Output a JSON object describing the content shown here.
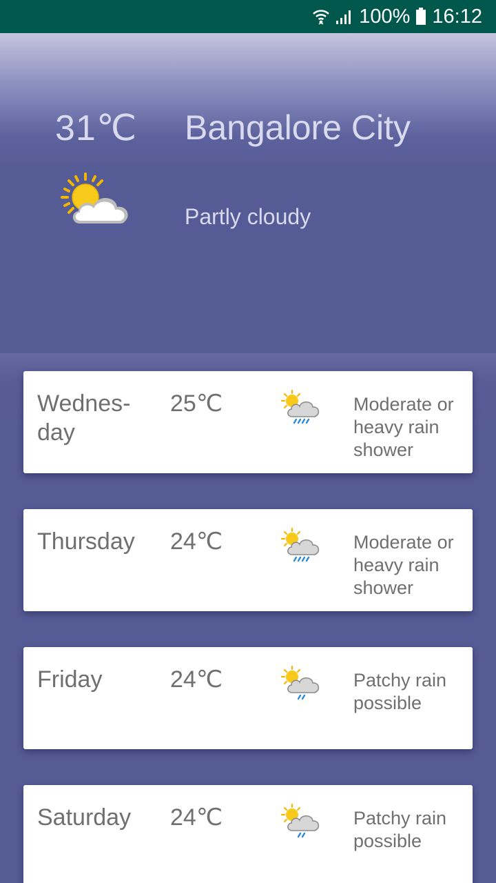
{
  "status_bar": {
    "battery": "100%",
    "time": "16:12"
  },
  "current": {
    "temperature": "31℃",
    "city": "Bangalore City",
    "condition": "Partly cloudy",
    "icon": "partly-cloudy-icon"
  },
  "forecast": [
    {
      "day": "Wednes-\nday",
      "temp": "25℃",
      "condition": "Moderate or heavy rain shower",
      "icon": "sun-cloud-rain-icon"
    },
    {
      "day": "Thursday",
      "temp": "24℃",
      "condition": "Moderate or heavy rain shower",
      "icon": "sun-cloud-rain-icon"
    },
    {
      "day": "Friday",
      "temp": "24℃",
      "condition": "Patchy rain possible",
      "icon": "sun-cloud-light-rain-icon"
    },
    {
      "day": "Saturday",
      "temp": "24℃",
      "condition": "Patchy rain possible",
      "icon": "sun-cloud-light-rain-icon"
    }
  ],
  "colors": {
    "status_bar": "#00584d",
    "background": "#555b95",
    "header_text": "#d9daee",
    "card_text": "#6f6f6f",
    "sun": "#f5c518",
    "rain": "#2a8ad8"
  }
}
